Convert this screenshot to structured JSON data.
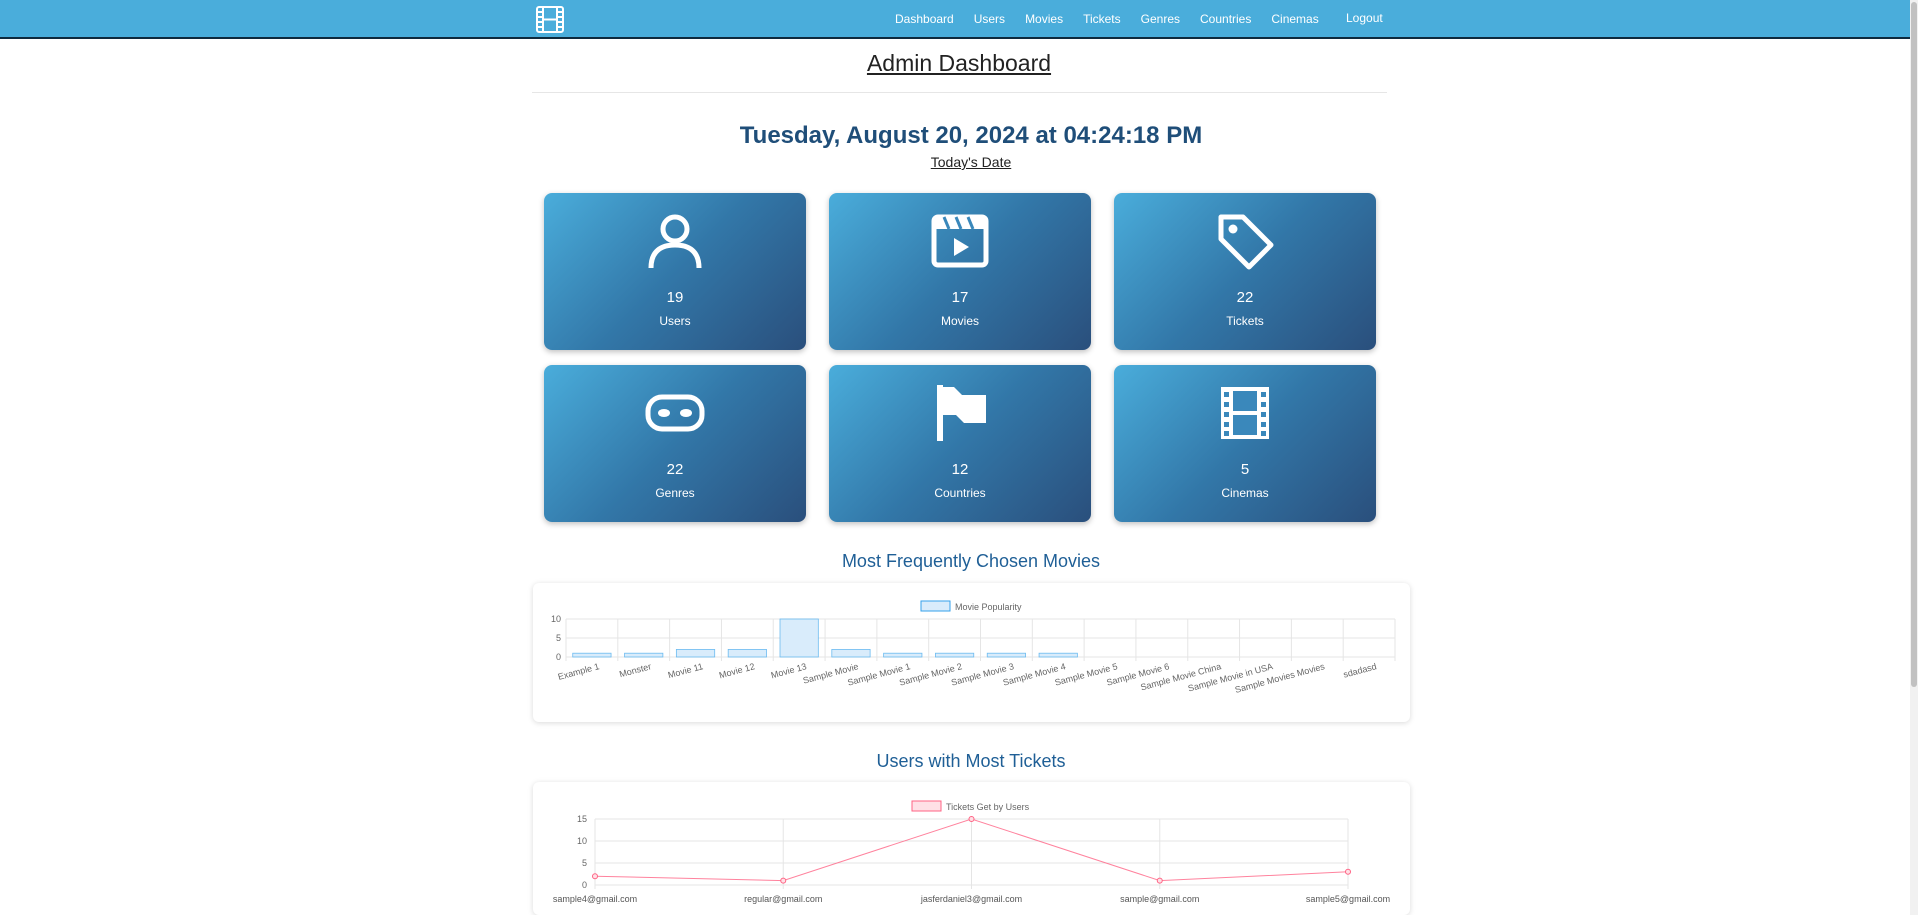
{
  "nav": {
    "links": [
      "Dashboard",
      "Users",
      "Movies",
      "Tickets",
      "Genres",
      "Countries",
      "Cinemas"
    ],
    "logout": "Logout"
  },
  "header": {
    "title": "Admin Dashboard",
    "datetime": "Tuesday, August 20, 2024 at 04:24:18 PM",
    "date_caption": "Today's Date"
  },
  "stats": [
    {
      "icon": "user-icon",
      "value": "19",
      "label": "Users"
    },
    {
      "icon": "clapperboard-icon",
      "value": "17",
      "label": "Movies"
    },
    {
      "icon": "tag-icon",
      "value": "22",
      "label": "Tickets"
    },
    {
      "icon": "mask-icon",
      "value": "22",
      "label": "Genres"
    },
    {
      "icon": "flag-icon",
      "value": "12",
      "label": "Countries"
    },
    {
      "icon": "film-strip-icon",
      "value": "5",
      "label": "Cinemas"
    }
  ],
  "sections": {
    "movies_title": "Most Frequently Chosen Movies",
    "users_title": "Users with Most Tickets"
  },
  "colors": {
    "navbar": "#4aaddb",
    "accent_title": "#1f5f96",
    "bar_fill": "#d9ecfb",
    "bar_border": "#36a2eb",
    "line": "#ff6384",
    "line_fill": "#ffe0e6"
  },
  "chart_data": [
    {
      "type": "bar",
      "legend": [
        "Movie Popularity"
      ],
      "categories": [
        "Example 1",
        "Monster",
        "Movie 11",
        "Movie 12",
        "Movie 13",
        "Sample Movie",
        "Sample Movie 1",
        "Sample Movie 2",
        "Sample Movie 3",
        "Sample Movie 4",
        "Sample Movie 5",
        "Sample Movie 6",
        "Sample Movie China",
        "Sample Movie in USA",
        "Sample Movies Movies",
        "sdadasd"
      ],
      "series": [
        {
          "name": "Movie Popularity",
          "values": [
            1,
            1,
            2,
            2,
            10,
            2,
            1,
            1,
            1,
            1,
            0,
            0,
            0,
            0,
            0,
            0
          ]
        }
      ],
      "yticks": [
        "10",
        "5",
        "0"
      ],
      "ylim": [
        0,
        10
      ],
      "grid": true,
      "legend_position": "top"
    },
    {
      "type": "line",
      "legend": [
        "Tickets Get by Users"
      ],
      "categories": [
        "sample4@gmail.com",
        "regular@gmail.com",
        "jasferdaniel3@gmail.com",
        "sample@gmail.com",
        "sample5@gmail.com"
      ],
      "series": [
        {
          "name": "Tickets Get by Users",
          "values": [
            2,
            1,
            15,
            1,
            3
          ]
        }
      ],
      "yticks": [
        "15",
        "10",
        "5",
        "0"
      ],
      "ylim": [
        0,
        15
      ],
      "grid": true,
      "legend_position": "top"
    }
  ]
}
